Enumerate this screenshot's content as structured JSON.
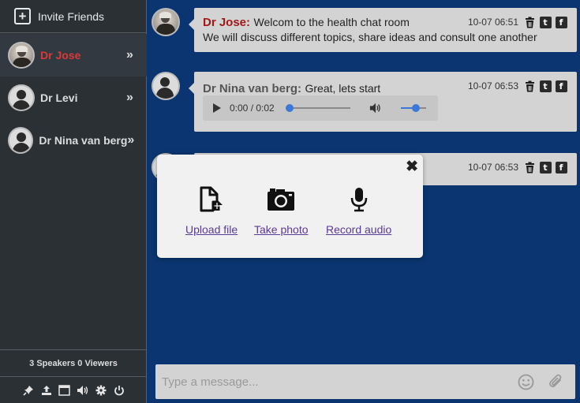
{
  "sidebar": {
    "invite_label": "Invite Friends",
    "users": [
      {
        "name": "Dr Jose",
        "active": true
      },
      {
        "name": "Dr Levi",
        "active": false
      },
      {
        "name": "Dr Nina van berg",
        "active": false
      }
    ],
    "chevron": "»",
    "stats": "3 Speakers 0 Viewers",
    "toolbar_icons": [
      "pin-icon",
      "upload-icon",
      "window-icon",
      "volume-icon",
      "gear-icon",
      "power-icon"
    ]
  },
  "messages": [
    {
      "sender": "Dr Jose:",
      "text": "Welcom to the health chat room",
      "text2": "We will discuss different topics, share ideas and consult one another",
      "time": "10-07 06:51",
      "sender_color": "#a01818"
    },
    {
      "sender": "Dr Nina van berg:",
      "text": "Great, lets start",
      "time": "10-07 06:53",
      "sender_color": "#555555",
      "audio": {
        "time_display": "0:00 / 0:02",
        "progress": 0.0,
        "volume": 0.6
      }
    },
    {
      "time": "10-07 06:53"
    }
  ],
  "popup": {
    "close": "✖",
    "options": [
      {
        "label": "Upload file",
        "icon": "file-upload-icon"
      },
      {
        "label": "Take photo",
        "icon": "camera-icon"
      },
      {
        "label": "Record audio",
        "icon": "microphone-icon"
      }
    ]
  },
  "composer": {
    "placeholder": "Type a message..."
  },
  "colors": {
    "background": "#0a3570",
    "sidebar": "#2b3035",
    "active_user": "#d83a3a",
    "bubble": "#d3d3d3",
    "link": "#5a3a96",
    "slider": "#3b78d8"
  }
}
